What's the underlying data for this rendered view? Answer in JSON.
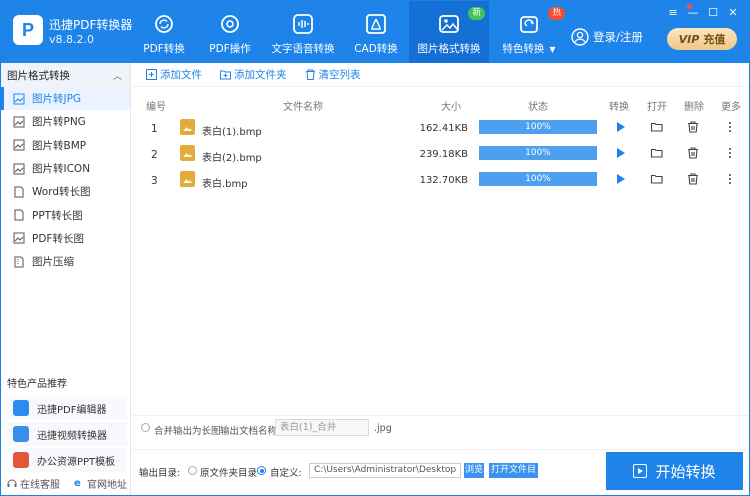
{
  "app": {
    "name": "迅捷PDF转换器",
    "version": "v8.8.2.0"
  },
  "nav": [
    {
      "label": "PDF转换",
      "icon": "refresh-icon"
    },
    {
      "label": "PDF操作",
      "icon": "gear-icon"
    },
    {
      "label": "文字语音转换",
      "icon": "audio-wave-icon"
    },
    {
      "label": "CAD转换",
      "icon": "cad-icon"
    },
    {
      "label": "图片格式转换",
      "icon": "image-icon",
      "badge": "新"
    },
    {
      "label": "特色转换",
      "icon": "special-icon",
      "badge": "热"
    }
  ],
  "header": {
    "login_label": "登录/注册",
    "vip_label": "VIP",
    "recharge_label": "充值"
  },
  "sidebar": {
    "section_title": "图片格式转换",
    "items": [
      {
        "label": "图片转JPG"
      },
      {
        "label": "图片转PNG"
      },
      {
        "label": "图片转BMP"
      },
      {
        "label": "图片转ICON"
      },
      {
        "label": "Word转长图"
      },
      {
        "label": "PPT转长图"
      },
      {
        "label": "PDF转长图"
      },
      {
        "label": "图片压缩"
      }
    ],
    "recommend_title": "特色产品推荐",
    "recommend": [
      {
        "label": "迅捷PDF编辑器"
      },
      {
        "label": "迅捷视频转换器"
      },
      {
        "label": "办公资源PPT模板"
      }
    ],
    "footer": {
      "support": "在线客服",
      "website": "官网地址"
    }
  },
  "toolbar": {
    "add_file": "添加文件",
    "add_folder": "添加文件夹",
    "clear_list": "清空列表"
  },
  "table": {
    "headers": {
      "num": "编号",
      "name": "文件名称",
      "size": "大小",
      "status": "状态",
      "convert": "转换",
      "open": "打开",
      "delete": "删除",
      "more": "更多"
    },
    "rows": [
      {
        "num": "1",
        "name": "表白(1).bmp",
        "size": "162.41KB",
        "progress": "100%",
        "progress_value": 100
      },
      {
        "num": "2",
        "name": "表白(2).bmp",
        "size": "239.18KB",
        "progress": "100%",
        "progress_value": 100
      },
      {
        "num": "3",
        "name": "表白.bmp",
        "size": "132.70KB",
        "progress": "100%",
        "progress_value": 100
      }
    ]
  },
  "merge": {
    "label": "合并输出为长图",
    "name_label": "输出文档名称:",
    "name_value": "表白(1)_合并",
    "ext": ".jpg"
  },
  "output": {
    "label": "输出目录:",
    "option_source": "原文件夹目录",
    "option_custom": "自定义:",
    "path": "C:\\Users\\Administrator\\Desktop",
    "browse": "浏览",
    "open_folder": "打开文件目录"
  },
  "start_label": "开始转换"
}
